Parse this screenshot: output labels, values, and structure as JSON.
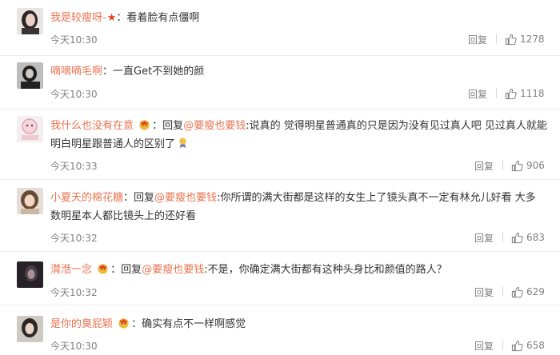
{
  "comments": [
    {
      "user": "我是较瘦呀-",
      "text": "看着脸有点僵啊",
      "time": "今天10:30",
      "reply_label": "回复",
      "likes": "1278"
    },
    {
      "user": "嘀嘀嘀毛啊",
      "text": "一直Get不到她的颜",
      "time": "今天10:30",
      "reply_label": "回复",
      "likes": "1118"
    },
    {
      "user": "我什么也没有在意",
      "reply_prefix": "回复",
      "mention": "@要瘦也要钱",
      "text_line1": ":说真的 觉得明星普通真的只是因为没有见过真人吧 见过真人就能",
      "text_line2": "明白明星跟普通人的区别了",
      "time": "今天10:33",
      "reply_label": "回复",
      "likes": "906"
    },
    {
      "user": "小夏天的棉花糖",
      "reply_prefix": "回复",
      "mention": "@要瘦也要钱",
      "text_line1": ":你所谓的满大街都是这样的女生上了镜头真不一定有林允儿好看 大多",
      "text_line2": "数明星本人都比镜头上的还好看",
      "time": "今天10:32",
      "reply_label": "回复",
      "likes": "683"
    },
    {
      "user": "潸湉一念",
      "reply_prefix": "回复",
      "mention": "@要瘦也要钱",
      "text": ":不是，你确定满大街都有这种头身比和颜值的路人？",
      "time": "今天10:32",
      "reply_label": "回复",
      "likes": "629"
    },
    {
      "user": "是你的臭屁颖",
      "text": "确实有点不一样啊感觉",
      "time": "今天10:30",
      "reply_label": "回复",
      "likes": "658"
    }
  ]
}
